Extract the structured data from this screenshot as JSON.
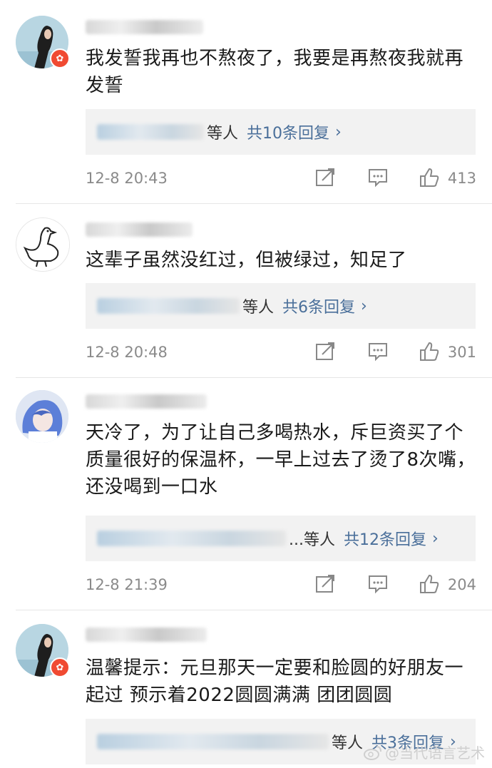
{
  "comments": [
    {
      "text": "我发誓我再也不熬夜了，我要是再熬夜我就再发誓",
      "replies_suffix": "等人",
      "replies_count": "共10条回复",
      "time": "12-8 20:43",
      "likes": "413",
      "avatar": "woman-portrait-avatar",
      "verified": true
    },
    {
      "text": "这辈子虽然没红过，但被绿过，知足了",
      "replies_suffix": "等人",
      "replies_count": "共6条回复",
      "time": "12-8 20:48",
      "likes": "301",
      "avatar": "goose-avatar",
      "verified": false
    },
    {
      "text": "天冷了，为了让自己多喝热水，斥巨资买了个质量很好的保温杯，一早上过去了烫了8次嘴，还没喝到一口水",
      "replies_suffix": "...等人",
      "replies_count": "共12条回复",
      "time": "12-8 21:39",
      "likes": "204",
      "avatar": "anime-girl-avatar",
      "verified": false
    },
    {
      "text": "温馨提示：元旦那天一定要和脸圆的好朋友一起过 预示着2022圆圆满满 团团圆圆",
      "replies_suffix": "等人",
      "replies_count": "共3条回复",
      "avatar": "woman-portrait-avatar",
      "verified": true
    }
  ],
  "watermark": "@当代语言艺术",
  "colors": {
    "link": "#4a6f9a",
    "meta": "#8a8a8a",
    "badge": "#f04a32",
    "reply_bg": "#f2f2f2"
  }
}
